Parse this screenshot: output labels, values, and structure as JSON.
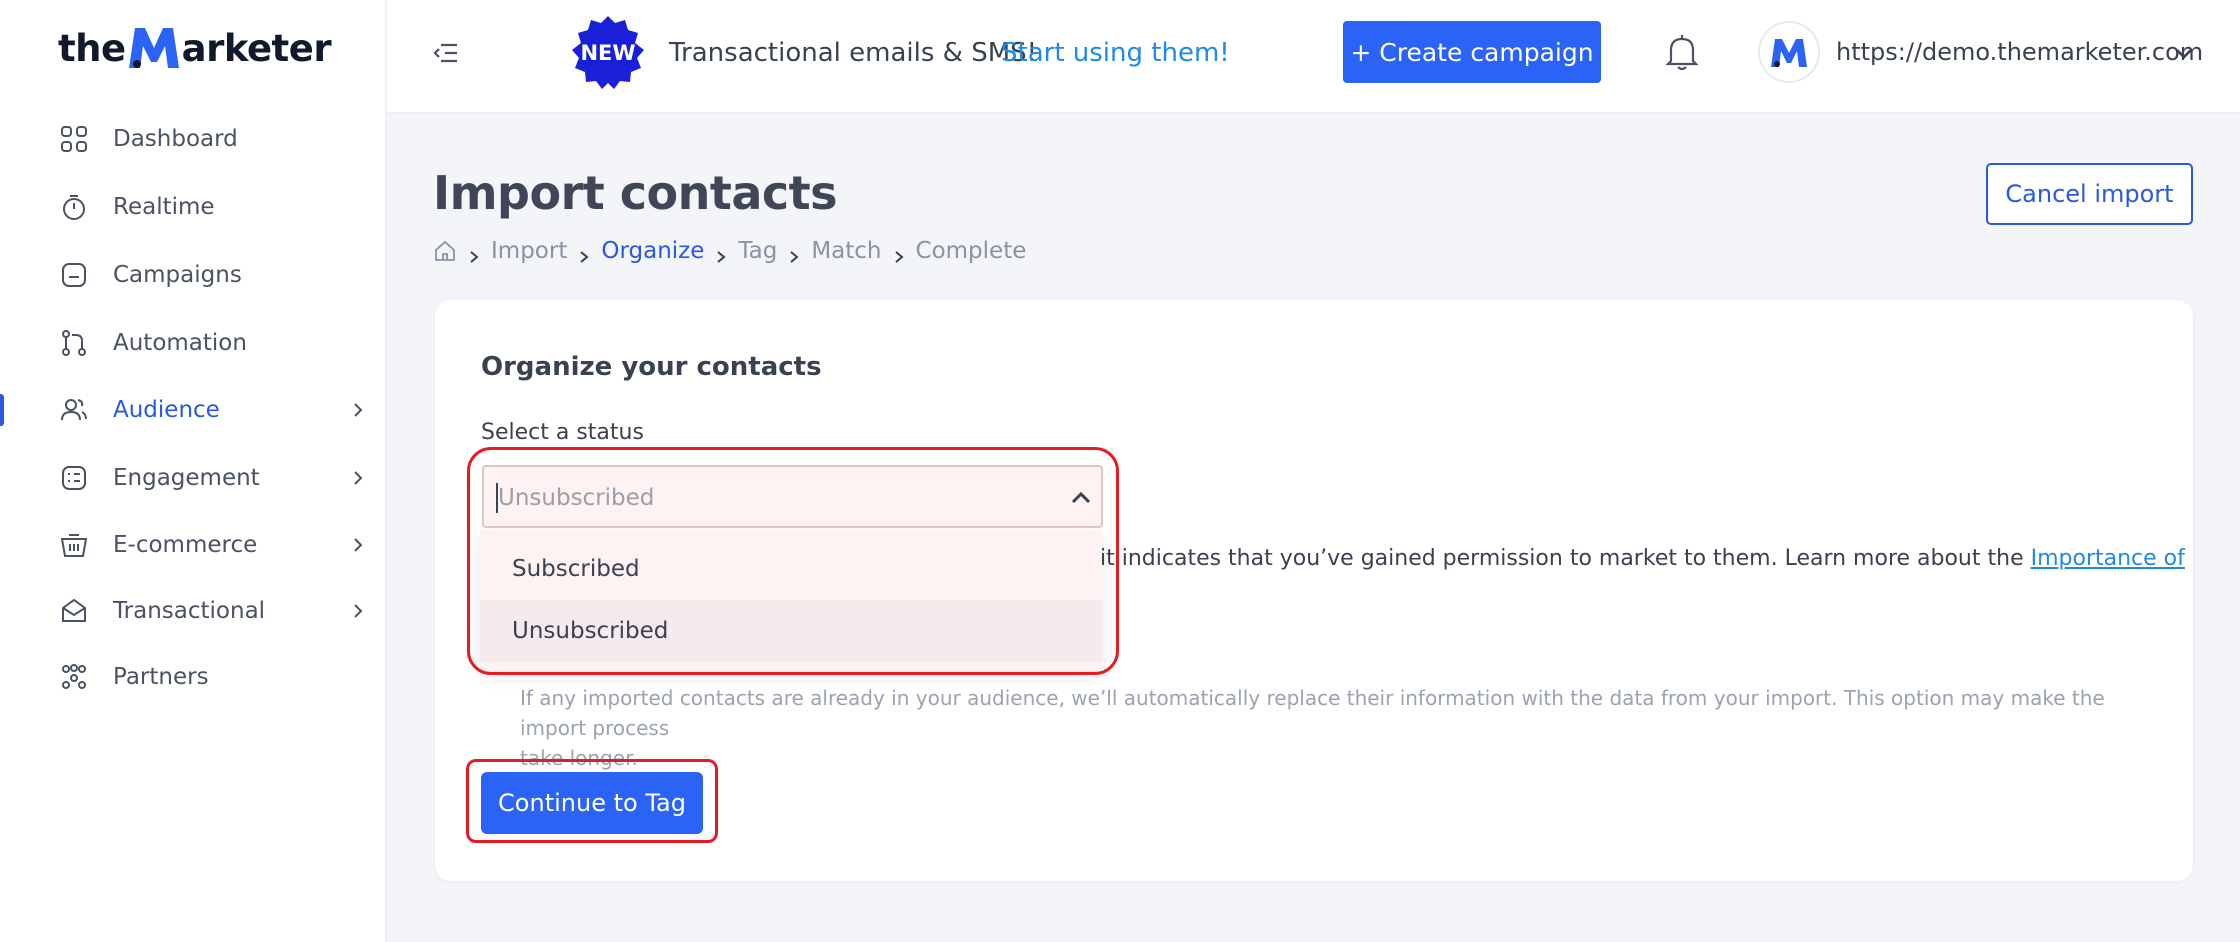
{
  "brand": {
    "logo_pre": "the",
    "logo_post": "arketer"
  },
  "sidebar": {
    "items": [
      {
        "label": "Dashboard",
        "icon": "dashboard-grid-icon"
      },
      {
        "label": "Realtime",
        "icon": "timer-icon"
      },
      {
        "label": "Campaigns",
        "icon": "campaign-icon"
      },
      {
        "label": "Automation",
        "icon": "automation-flow-icon"
      },
      {
        "label": "Audience",
        "icon": "audience-icon",
        "active": true
      },
      {
        "label": "Engagement",
        "icon": "engagement-icon"
      },
      {
        "label": "E-commerce",
        "icon": "basket-icon"
      },
      {
        "label": "Transactional",
        "icon": "envelope-icon"
      },
      {
        "label": "Partners",
        "icon": "partners-icon"
      }
    ]
  },
  "topbar": {
    "new_badge": "NEW",
    "promo_text": "Transactional emails & SMS!",
    "promo_link": "Start using them!",
    "create_button": "+ Create campaign",
    "account_url": "https://demo.themarketer.com"
  },
  "page": {
    "title": "Import contacts",
    "cancel_button": "Cancel import",
    "breadcrumb": [
      "Import",
      "Organize",
      "Tag",
      "Match",
      "Complete"
    ],
    "breadcrumb_current": "Organize"
  },
  "card": {
    "title": "Organize your contacts",
    "status_label": "Select a status",
    "select_placeholder": "Unsubscribed",
    "options": [
      "Subscribed",
      "Unsubscribed"
    ],
    "body_text": "it indicates that you’ve gained permission to market to them. Learn more about the ",
    "body_link": "Importance of",
    "helper_line1": "If any imported contacts are already in your audience, we’ll automatically replace their information with the data from your import. This option may make the import process",
    "helper_line2": "take longer.",
    "continue_button": "Continue to Tag"
  },
  "colors": {
    "accent": "#2a63f5",
    "link": "#1f8ae8",
    "highlight": "#e51c23"
  }
}
